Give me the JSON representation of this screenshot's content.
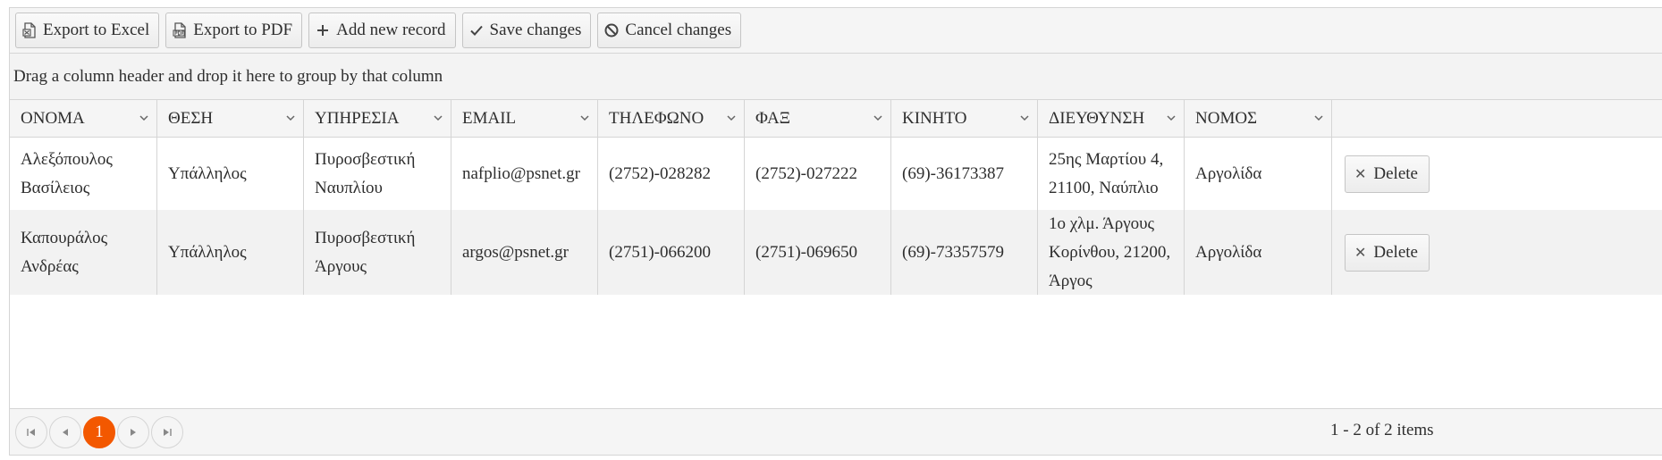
{
  "toolbar": {
    "export_excel": "Export to Excel",
    "export_pdf": "Export to PDF",
    "add_record": "Add new record",
    "save_changes": "Save changes",
    "cancel_changes": "Cancel changes"
  },
  "grouping": {
    "hint": "Drag a column header and drop it here to group by that column"
  },
  "columns": [
    "ΟΝΟΜΑ",
    "ΘΕΣΗ",
    "ΥΠΗΡΕΣΙΑ",
    "EMAIL",
    "ΤΗΛΕΦΩΝΟ",
    "ΦΑΞ",
    "ΚΙΝΗΤΟ",
    "ΔΙΕΥΘΥΝΣΗ",
    "ΝΟΜΟΣ"
  ],
  "rows": [
    {
      "name": "Αλεξόπουλος Βασίλειος",
      "position": "Υπάλληλος",
      "service": "Πυροσβεστική Ναυπλίου",
      "email": "nafplio@psnet.gr",
      "phone": "(2752)-028282",
      "fax": "(2752)-027222",
      "mobile": "(69)-36173387",
      "address": "25ης Μαρτίου 4, 21100, Ναύπλιο",
      "prefecture": "Αργολίδα",
      "delete_label": "Delete"
    },
    {
      "name": "Καπουράλος Ανδρέας",
      "position": "Υπάλληλος",
      "service": "Πυροσβεστική Άργους",
      "email": "argos@psnet.gr",
      "phone": "(2751)-066200",
      "fax": "(2751)-069650",
      "mobile": "(69)-73357579",
      "address": "1ο χλμ. Άργους Κορίνθου, 21200, Άργος",
      "prefecture": "Αργολίδα",
      "delete_label": "Delete"
    }
  ],
  "pager": {
    "current_page": "1",
    "info": "1 - 2 of 2 items"
  },
  "colors": {
    "accent": "#f35800",
    "header_bg": "#f5f5f5",
    "border": "#d5d5d5",
    "alt_row": "#f2f2f2"
  },
  "icons": {
    "excel": "excel-file-icon",
    "pdf": "pdf-file-icon",
    "add": "plus-icon",
    "save": "check-icon",
    "cancel": "cancel-icon",
    "delete": "close-icon"
  }
}
